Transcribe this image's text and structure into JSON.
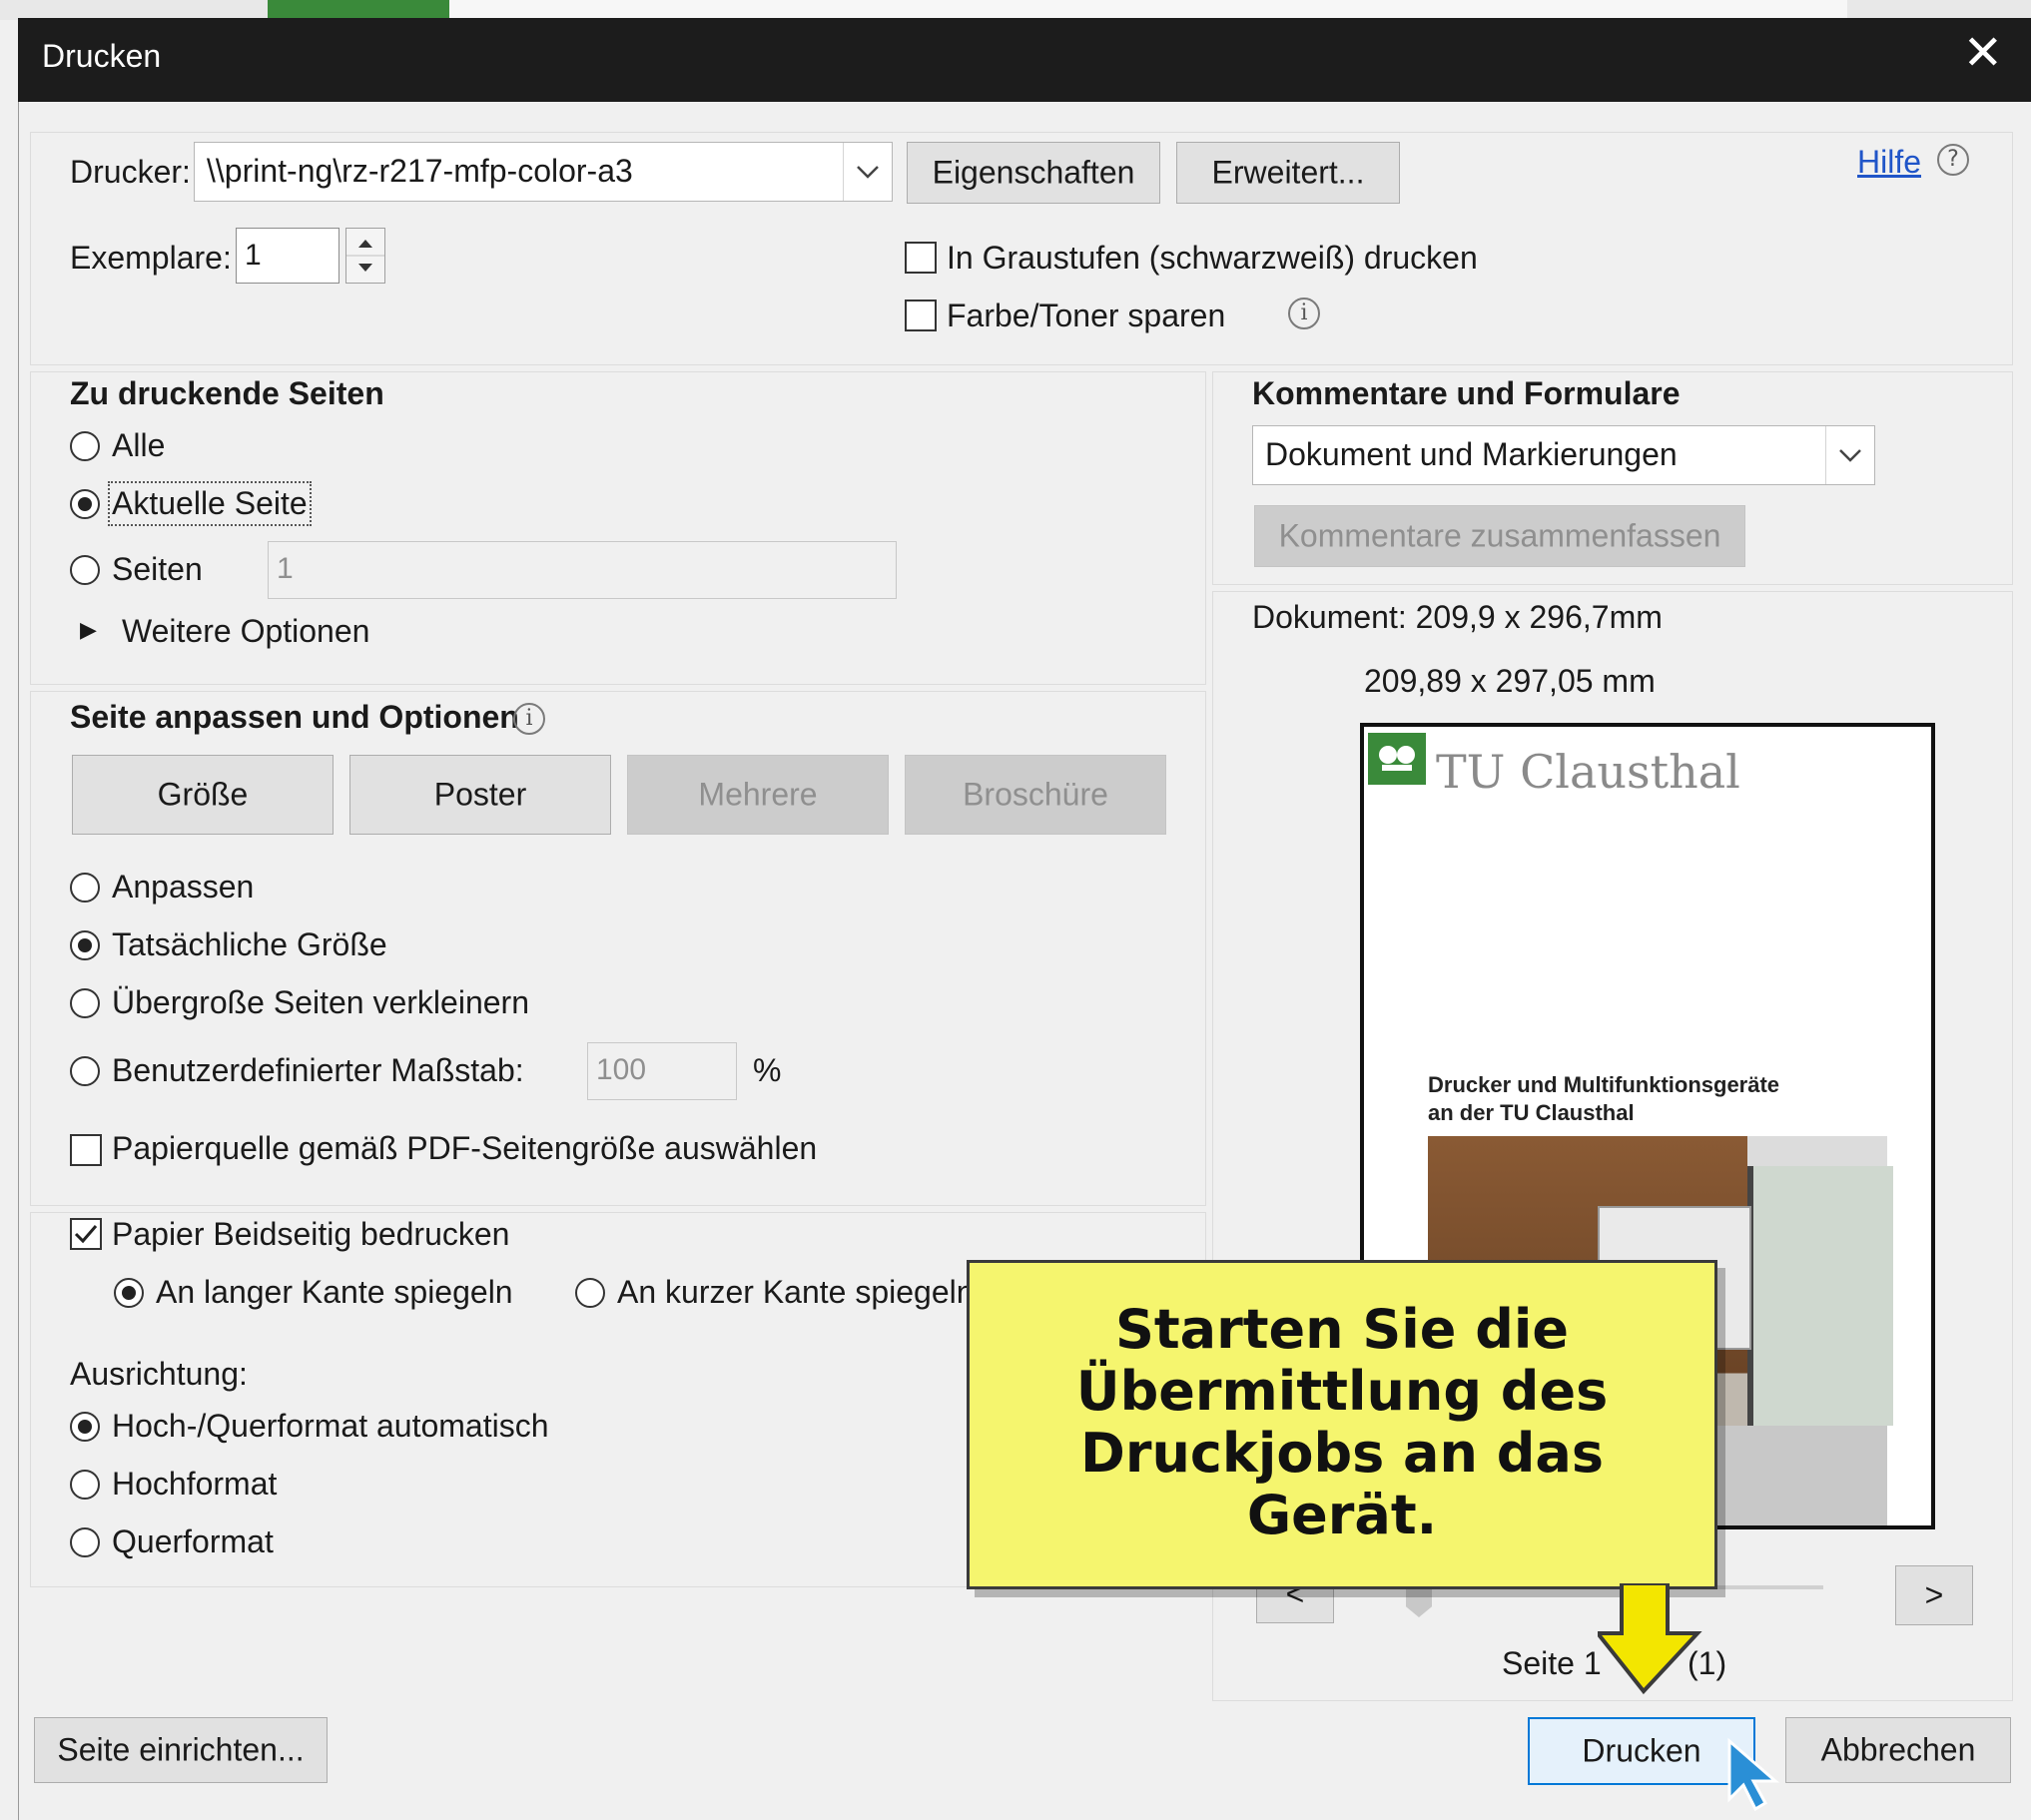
{
  "dialog": {
    "title": "Drucken",
    "close_glyph": "✕"
  },
  "printer": {
    "label": "Drucker:",
    "value": "\\\\print-ng\\rz-r217-mfp-color-a3",
    "properties_button": "Eigenschaften",
    "advanced_button": "Erweitert...",
    "help_link": "Hilfe",
    "help_glyph": "?"
  },
  "copies": {
    "label": "Exemplare:",
    "value": "1"
  },
  "options": {
    "grayscale": {
      "label": "In Graustufen (schwarzweiß) drucken",
      "checked": false
    },
    "save_toner": {
      "label": "Farbe/Toner sparen",
      "checked": false
    },
    "info_glyph": "i"
  },
  "pages": {
    "heading": "Zu druckende Seiten",
    "all": "Alle",
    "current": "Aktuelle Seite",
    "range": "Seiten",
    "range_value": "1",
    "more": "Weitere Optionen",
    "more_glyph": "▶",
    "selected": "current"
  },
  "fit": {
    "heading": "Seite anpassen und Optionen",
    "buttons": {
      "size": "Größe",
      "poster": "Poster",
      "multiple": "Mehrere",
      "booklet": "Broschüre"
    },
    "fit_option": "Anpassen",
    "actual_size": "Tatsächliche Größe",
    "shrink": "Übergroße Seiten verkleinern",
    "custom_scale": "Benutzerdefinierter Maßstab:",
    "scale_value": "100",
    "percent": "%",
    "paper_source": "Papierquelle gemäß PDF-Seitengröße auswählen",
    "selected": "actual_size"
  },
  "duplex": {
    "label": "Papier Beidseitig bedrucken",
    "checked": true,
    "long_edge": "An langer Kante spiegeln",
    "short_edge": "An kurzer Kante spiegeln",
    "selected": "long_edge"
  },
  "orientation": {
    "label": "Ausrichtung:",
    "auto": "Hoch-/Querformat automatisch",
    "portrait": "Hochformat",
    "landscape": "Querformat",
    "selected": "auto"
  },
  "comments": {
    "heading": "Kommentare und Formulare",
    "value": "Dokument und Markierungen",
    "summarize_button": "Kommentare zusammenfassen"
  },
  "preview": {
    "document_size": "Dokument: 209,9 x 296,7mm",
    "page_size": "209,89 x 297,05 mm",
    "page_title": "TU Clausthal",
    "page_heading_line1": "Drucker und Multifunktionsgeräte",
    "page_heading_line2": "an der TU Clausthal",
    "prev": "<",
    "next": ">",
    "page_indicator_start": "Seite 1",
    "page_indicator_end": "(1)"
  },
  "footer": {
    "page_setup_button": "Seite einrichten...",
    "print_button": "Drucken",
    "cancel_button": "Abbrechen"
  },
  "callout": {
    "line1": "Starten Sie die",
    "line2": "Übermittlung des",
    "line3": "Druckjobs an das",
    "line4": "Gerät."
  },
  "colors": {
    "titlebar": "#1c1c1c",
    "callout_bg": "#f5f56e",
    "link": "#2055c8",
    "primary_border": "#0078d7",
    "arrow_fill": "#f3e600"
  }
}
